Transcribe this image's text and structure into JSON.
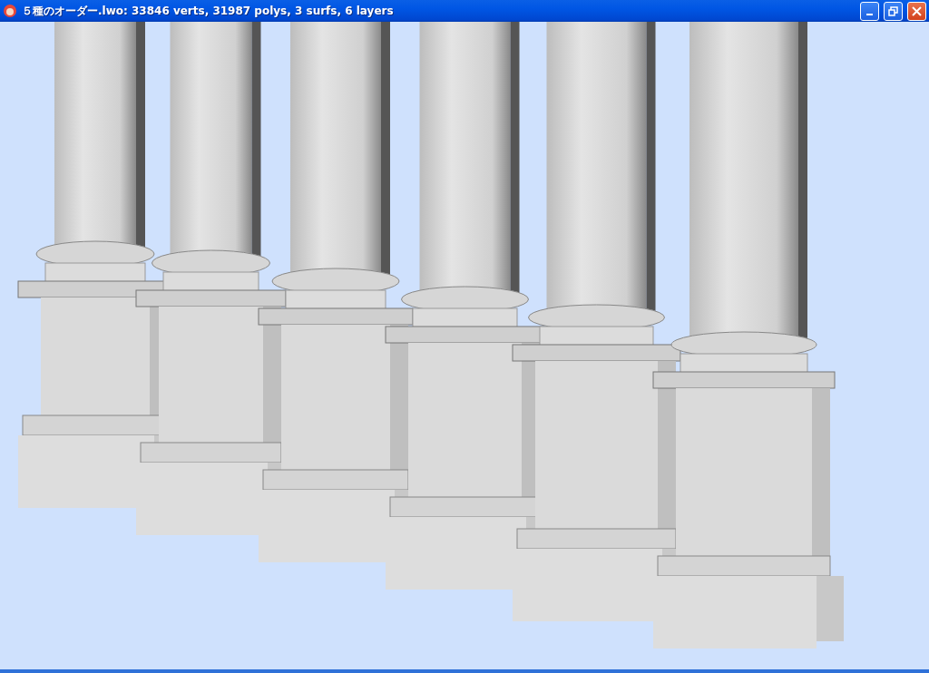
{
  "window": {
    "title": "５種のオーダー.lwo: 33846 verts, 31987 polys, 3 surfs, 6 layers"
  }
}
